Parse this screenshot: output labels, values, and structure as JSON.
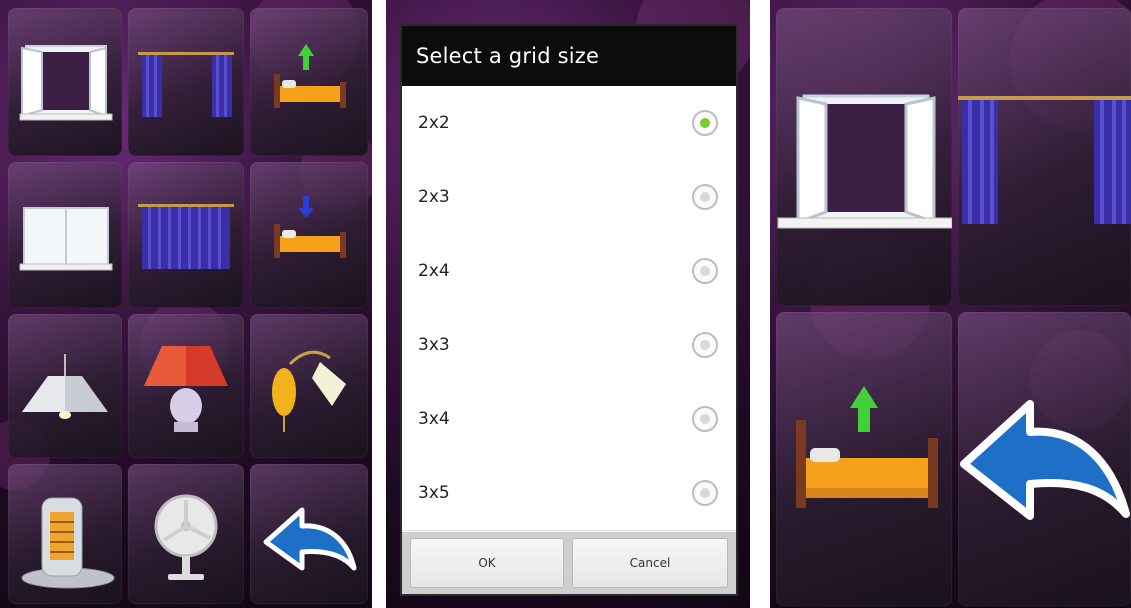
{
  "dialog": {
    "title": "Select a grid size",
    "options": [
      {
        "label": "2x2",
        "selected": true
      },
      {
        "label": "2x3",
        "selected": false
      },
      {
        "label": "2x4",
        "selected": false
      },
      {
        "label": "3x3",
        "selected": false
      },
      {
        "label": "3x4",
        "selected": false
      },
      {
        "label": "3x5",
        "selected": false
      }
    ],
    "ok_label": "OK",
    "cancel_label": "Cancel"
  },
  "left_grid": {
    "tiles": [
      {
        "icon": "open-window-icon"
      },
      {
        "icon": "open-curtains-icon"
      },
      {
        "icon": "bed-up-icon"
      },
      {
        "icon": "closed-window-icon"
      },
      {
        "icon": "closed-curtains-icon"
      },
      {
        "icon": "bed-down-icon"
      },
      {
        "icon": "ceiling-lamp-icon"
      },
      {
        "icon": "table-lamp-icon"
      },
      {
        "icon": "wall-lamp-icon"
      },
      {
        "icon": "heater-icon"
      },
      {
        "icon": "fan-icon"
      },
      {
        "icon": "back-arrow-icon"
      }
    ]
  },
  "right_grid": {
    "tiles": [
      {
        "icon": "open-window-icon"
      },
      {
        "icon": "open-curtains-icon"
      },
      {
        "icon": "bed-up-icon"
      },
      {
        "icon": "back-arrow-icon"
      }
    ]
  },
  "colors": {
    "background_purple": "#3a1440",
    "selected_radio": "#7acb2c",
    "arrow_blue": "#1e6fc8",
    "arrow_up_green": "#3fd03a",
    "arrow_down_blue": "#2b3fd6",
    "curtain_blue": "#3b2fa8",
    "bed_orange": "#f5a21a"
  }
}
